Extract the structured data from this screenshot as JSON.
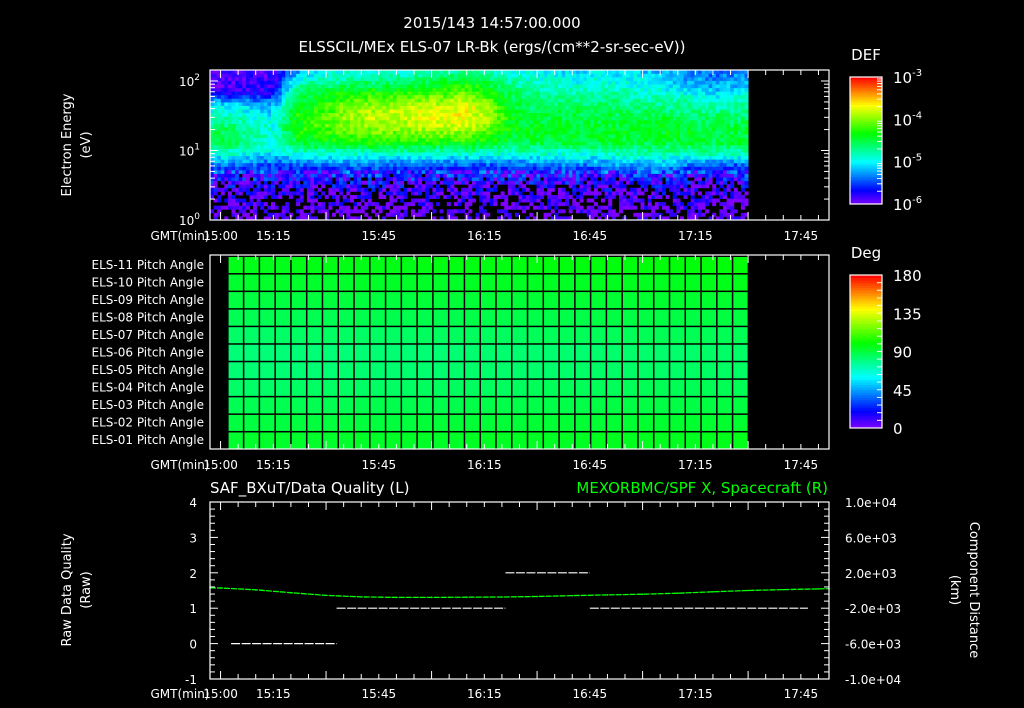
{
  "header": {
    "timestamp": "2015/143 14:57:00.000"
  },
  "chart_data": [
    {
      "type": "heatmap",
      "title": "ELSSCIL/MEx ELS-07 LR-Bk  (ergs/(cm**2-sr-sec-eV))",
      "ylabel": "Electron Energy",
      "yunits": "(eV)",
      "xlabel": "GMT(min)",
      "x_start": "14:57",
      "x_end": "17:53",
      "data_start": "14:57",
      "data_end": "17:30",
      "x_tick_labels": [
        "15:00",
        "15:15",
        "15:45",
        "16:15",
        "16:45",
        "17:15",
        "17:45"
      ],
      "y_scale": "log",
      "ylim": [
        1,
        145
      ],
      "y_tick_labels": [
        {
          "base": "10",
          "exp": "2",
          "value": 100
        },
        {
          "base": "10",
          "exp": "1",
          "value": 10
        },
        {
          "base": "10",
          "exp": "0",
          "value": 1
        }
      ],
      "colorbar": {
        "label": "DEF",
        "scale": "log",
        "range": [
          -6,
          -3
        ],
        "tick_labels": [
          {
            "base": "10",
            "exp": "-3"
          },
          {
            "base": "10",
            "exp": "-4"
          },
          {
            "base": "10",
            "exp": "-5"
          },
          {
            "base": "10",
            "exp": "-6"
          }
        ]
      },
      "energies_eV": [
        1.2,
        1.8,
        2.7,
        4,
        6,
        9,
        13,
        20,
        30,
        45,
        70,
        105,
        140
      ],
      "time_bins": 26,
      "log10_def": [
        [
          -6.2,
          -6.2,
          -6.2,
          -6.2,
          -6.2,
          -6.2,
          -6.2,
          -6.2,
          -6.2,
          -6.2,
          -6.2,
          -6.2,
          -6.2,
          -6.2,
          -6.2,
          -6.2,
          -6.2,
          -6.2,
          -6.2,
          -6.2,
          -6.2,
          -6.2,
          -6.2,
          -6.2,
          -6.2,
          -6.2
        ],
        [
          -6.1,
          -6.1,
          -6.1,
          -6.1,
          -6.1,
          -6.1,
          -6.1,
          -6.1,
          -6.1,
          -6.1,
          -6.1,
          -6.1,
          -6.1,
          -6.1,
          -6.1,
          -6.1,
          -6.1,
          -6.1,
          -6.1,
          -6.1,
          -6.1,
          -6.1,
          -6.1,
          -6.1,
          -6.1,
          -6.1
        ],
        [
          -6.0,
          -6.0,
          -6.0,
          -6.0,
          -6.0,
          -6.0,
          -6.0,
          -6.0,
          -6.0,
          -6.0,
          -6.0,
          -6.0,
          -6.0,
          -6.0,
          -6.0,
          -6.0,
          -6.0,
          -6.0,
          -6.0,
          -6.0,
          -6.0,
          -6.0,
          -6.0,
          -6.0,
          -6.0,
          -6.0
        ],
        [
          -5.8,
          -5.8,
          -5.8,
          -5.8,
          -5.8,
          -5.8,
          -5.8,
          -5.8,
          -5.8,
          -5.8,
          -5.8,
          -5.8,
          -5.8,
          -5.8,
          -5.8,
          -5.8,
          -5.8,
          -5.8,
          -5.8,
          -5.8,
          -5.8,
          -5.8,
          -5.8,
          -5.8,
          -5.8,
          -5.8
        ],
        [
          -5.4,
          -5.4,
          -5.5,
          -5.5,
          -5.5,
          -5.5,
          -5.4,
          -5.4,
          -5.4,
          -5.5,
          -5.5,
          -5.5,
          -5.5,
          -5.5,
          -5.5,
          -5.4,
          -5.4,
          -5.4,
          -5.4,
          -5.3,
          -5.3,
          -5.2,
          -5.4,
          -5.5,
          -5.5,
          -5.5
        ],
        [
          -4.9,
          -4.9,
          -5.0,
          -5.1,
          -4.9,
          -4.9,
          -4.9,
          -4.9,
          -4.9,
          -4.9,
          -4.9,
          -4.9,
          -4.9,
          -4.9,
          -4.9,
          -4.9,
          -4.9,
          -4.9,
          -4.9,
          -4.8,
          -4.8,
          -4.8,
          -4.8,
          -4.8,
          -4.8,
          -4.8
        ],
        [
          -4.5,
          -4.5,
          -4.8,
          -4.9,
          -4.5,
          -4.4,
          -4.4,
          -4.3,
          -4.3,
          -4.3,
          -4.3,
          -4.3,
          -4.3,
          -4.4,
          -4.5,
          -4.5,
          -4.5,
          -4.5,
          -4.5,
          -4.5,
          -4.5,
          -4.5,
          -4.5,
          -4.5,
          -4.5,
          -4.5
        ],
        [
          -4.6,
          -4.6,
          -4.8,
          -4.9,
          -4.3,
          -4.2,
          -4.1,
          -4.0,
          -4.0,
          -4.0,
          -3.9,
          -3.9,
          -3.9,
          -4.1,
          -4.4,
          -4.4,
          -4.4,
          -4.4,
          -4.4,
          -4.4,
          -4.4,
          -4.4,
          -4.4,
          -4.5,
          -4.5,
          -4.5
        ],
        [
          -4.8,
          -4.8,
          -4.9,
          -5.0,
          -4.3,
          -4.2,
          -4.0,
          -3.9,
          -3.8,
          -3.8,
          -3.7,
          -3.7,
          -3.7,
          -3.9,
          -4.4,
          -4.5,
          -4.5,
          -4.5,
          -4.5,
          -4.5,
          -4.5,
          -4.5,
          -4.6,
          -4.6,
          -4.6,
          -4.6
        ],
        [
          -5.0,
          -5.0,
          -5.1,
          -5.2,
          -4.4,
          -4.3,
          -4.1,
          -4.0,
          -3.9,
          -3.9,
          -3.8,
          -3.8,
          -3.7,
          -4.0,
          -4.5,
          -4.6,
          -4.6,
          -4.6,
          -4.6,
          -4.6,
          -4.7,
          -4.7,
          -4.7,
          -4.8,
          -4.8,
          -4.7
        ],
        [
          -5.8,
          -5.8,
          -5.8,
          -5.7,
          -4.6,
          -4.5,
          -4.4,
          -4.3,
          -4.3,
          -4.3,
          -4.2,
          -4.2,
          -4.1,
          -4.3,
          -4.6,
          -4.7,
          -4.8,
          -4.8,
          -4.8,
          -4.8,
          -4.9,
          -4.9,
          -5.0,
          -5.1,
          -5.1,
          -5.0
        ],
        [
          -5.9,
          -5.9,
          -5.8,
          -5.8,
          -5.0,
          -4.8,
          -4.8,
          -4.7,
          -4.7,
          -4.7,
          -4.6,
          -4.5,
          -4.4,
          -4.6,
          -4.8,
          -4.9,
          -4.9,
          -5.0,
          -4.9,
          -5.0,
          -5.0,
          -5.1,
          -5.2,
          -5.3,
          -5.3,
          -5.2
        ],
        [
          -5.9,
          -5.9,
          -5.9,
          -5.8,
          -5.3,
          -5.0,
          -4.9,
          -4.9,
          -4.9,
          -4.9,
          -4.8,
          -4.8,
          -4.7,
          -4.8,
          -4.9,
          -5.0,
          -5.0,
          -5.1,
          -5.0,
          -5.1,
          -5.1,
          -5.2,
          -5.3,
          -5.4,
          -5.4,
          -5.3
        ]
      ]
    },
    {
      "type": "heatmap",
      "xlabel": "GMT(min)",
      "x_start": "14:57",
      "x_end": "17:53",
      "data_start": "15:02",
      "data_end": "17:30",
      "x_tick_labels": [
        "15:00",
        "15:15",
        "15:45",
        "16:15",
        "16:45",
        "17:15",
        "17:45"
      ],
      "time_bins": 33,
      "rows": [
        {
          "label": "ELS-11 Pitch Angle",
          "deg": 92
        },
        {
          "label": "ELS-10 Pitch Angle",
          "deg": 88
        },
        {
          "label": "ELS-09 Pitch Angle",
          "deg": 84
        },
        {
          "label": "ELS-08 Pitch Angle",
          "deg": 80
        },
        {
          "label": "ELS-07 Pitch Angle",
          "deg": 76
        },
        {
          "label": "ELS-06 Pitch Angle",
          "deg": 72
        },
        {
          "label": "ELS-05 Pitch Angle",
          "deg": 73
        },
        {
          "label": "ELS-04 Pitch Angle",
          "deg": 76
        },
        {
          "label": "ELS-03 Pitch Angle",
          "deg": 80
        },
        {
          "label": "ELS-02 Pitch Angle",
          "deg": 84
        },
        {
          "label": "ELS-01 Pitch Angle",
          "deg": 88
        }
      ],
      "colorbar": {
        "label": "Deg",
        "range": [
          0,
          180
        ],
        "tick_labels": [
          "180",
          "135",
          "90",
          "45",
          "0"
        ]
      }
    },
    {
      "type": "line",
      "title_left": "SAF_BXuT/Data Quality (L)",
      "title_right": "MEXORBMC/SPF X, Spacecraft (R)",
      "title_right_color": "#00ff00",
      "xlabel": "GMT(min)",
      "x_start": "14:57",
      "x_end": "17:53",
      "x_tick_labels": [
        "15:00",
        "15:15",
        "15:45",
        "16:15",
        "16:45",
        "17:15",
        "17:45"
      ],
      "ylabel_left": "Raw Data Quality",
      "yunits_left": "(Raw)",
      "ylim_left": [
        -1,
        4
      ],
      "yticks_left": [
        "4",
        "3",
        "2",
        "1",
        "0",
        "-1"
      ],
      "ylabel_right": "Component Distance",
      "yunits_right": "(km)",
      "ylim_right": [
        -10000,
        10000
      ],
      "yticks_right": [
        "1.0e+04",
        "6.0e+03",
        "2.0e+03",
        "-2.0e+03",
        "-6.0e+03",
        "-1.0e+04"
      ],
      "quality_segments": [
        {
          "start": "15:03",
          "end": "15:33",
          "value": 0
        },
        {
          "start": "15:33",
          "end": "16:21",
          "value": 1
        },
        {
          "start": "16:21",
          "end": "16:45",
          "value": 2
        },
        {
          "start": "16:45",
          "end": "17:47",
          "value": 1
        }
      ],
      "spf_x_km": {
        "color": "#00ff00",
        "t": [
          "14:57",
          "15:00",
          "15:10",
          "15:20",
          "15:30",
          "15:40",
          "15:50",
          "16:00",
          "16:10",
          "16:20",
          "16:30",
          "16:40",
          "16:50",
          "17:00",
          "17:10",
          "17:20",
          "17:30",
          "17:40",
          "17:50",
          "17:53"
        ],
        "values": [
          300,
          280,
          80,
          -250,
          -550,
          -720,
          -780,
          -780,
          -760,
          -740,
          -680,
          -580,
          -500,
          -420,
          -300,
          -150,
          0,
          100,
          180,
          200
        ]
      }
    }
  ]
}
